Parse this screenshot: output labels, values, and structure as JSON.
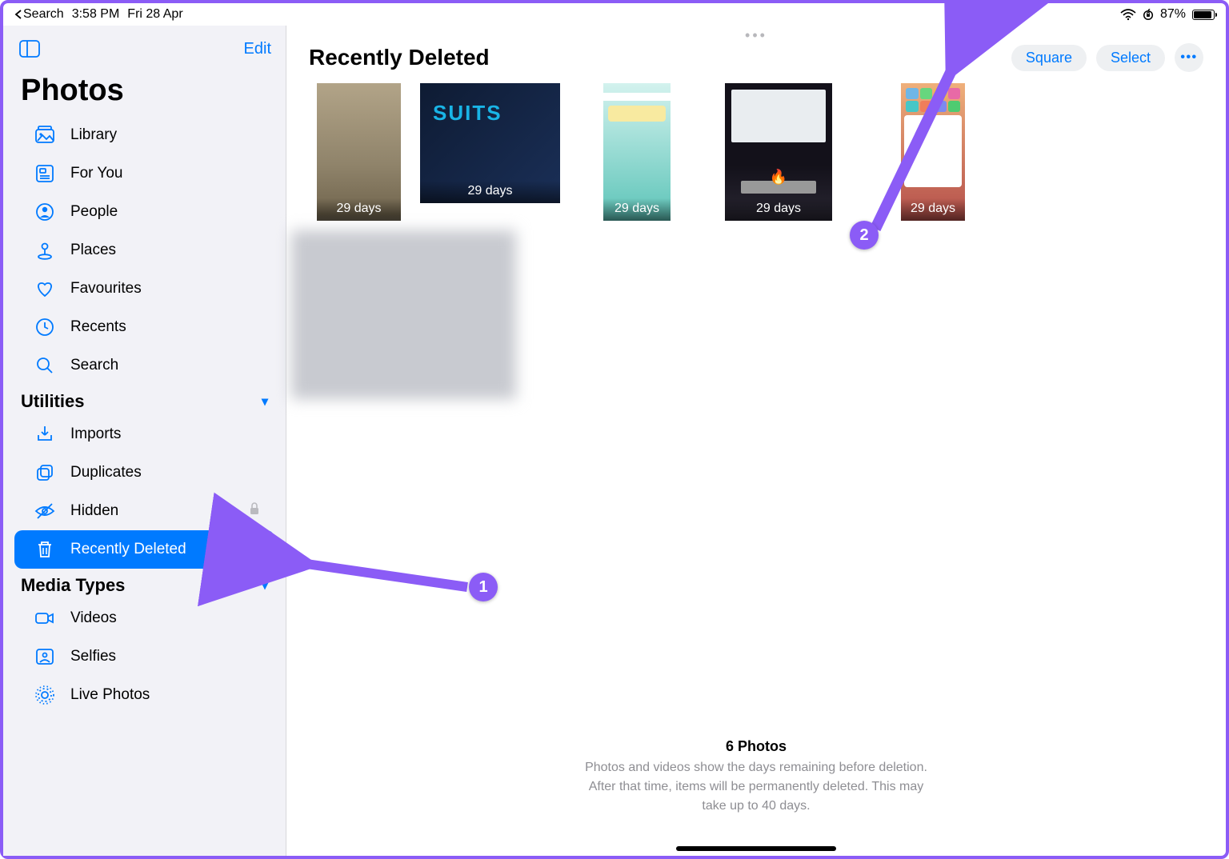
{
  "status": {
    "back_app": "Search",
    "time": "3:58 PM",
    "date": "Fri 28 Apr",
    "battery_pct": "87%"
  },
  "sidebar": {
    "edit": "Edit",
    "app_title": "Photos",
    "main_items": [
      {
        "label": "Library",
        "icon": "library"
      },
      {
        "label": "For You",
        "icon": "foryou"
      },
      {
        "label": "People",
        "icon": "people"
      },
      {
        "label": "Places",
        "icon": "places"
      },
      {
        "label": "Favourites",
        "icon": "heart"
      },
      {
        "label": "Recents",
        "icon": "clock"
      },
      {
        "label": "Search",
        "icon": "search"
      }
    ],
    "sections": {
      "utilities": {
        "title": "Utilities",
        "items": [
          {
            "label": "Imports",
            "icon": "import"
          },
          {
            "label": "Duplicates",
            "icon": "dup"
          },
          {
            "label": "Hidden",
            "icon": "eye-off",
            "trailing": "lock"
          },
          {
            "label": "Recently Deleted",
            "icon": "trash",
            "trailing": "unlock",
            "selected": true
          }
        ]
      },
      "media_types": {
        "title": "Media Types",
        "items": [
          {
            "label": "Videos",
            "icon": "video"
          },
          {
            "label": "Selfies",
            "icon": "selfie"
          },
          {
            "label": "Live Photos",
            "icon": "live"
          }
        ]
      }
    }
  },
  "content": {
    "title": "Recently Deleted",
    "actions": {
      "square": "Square",
      "select": "Select"
    },
    "thumbs": [
      {
        "days": "29 days"
      },
      {
        "days": "29 days",
        "overlay": "SUITS"
      },
      {
        "days": "29 days"
      },
      {
        "days": "29 days"
      },
      {
        "days": "29 days"
      },
      {
        "days": ""
      }
    ],
    "footer": {
      "count": "6 Photos",
      "line1": "Photos and videos show the days remaining before deletion.",
      "line2": "After that time, items will be permanently deleted. This may",
      "line3": "take up to 40 days."
    }
  },
  "annotations": {
    "one": "1",
    "two": "2"
  }
}
